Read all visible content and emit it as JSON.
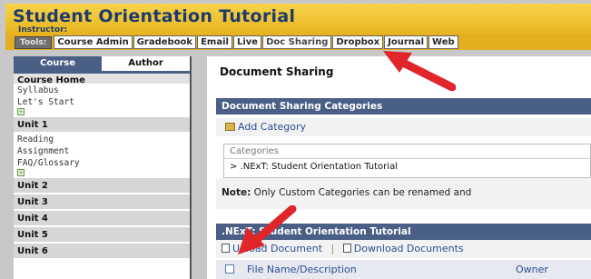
{
  "header": {
    "title": "Student Orientation Tutorial",
    "instructor_label": "Instructor:"
  },
  "toolbar": {
    "tools_label": "Tools:",
    "tabs": [
      "Course Admin",
      "Gradebook",
      "Email",
      "Live",
      "Doc Sharing",
      "Dropbox",
      "Journal",
      "Web"
    ]
  },
  "sidebar": {
    "tabs": [
      "Course",
      "Author"
    ],
    "course_home": "Course Home",
    "course_home_links": [
      "Syllabus",
      "Let's Start"
    ],
    "unit1": "Unit 1",
    "unit1_links": [
      "Reading",
      "Assignment",
      "FAQ/Glossary"
    ],
    "units": [
      "Unit 2",
      "Unit 3",
      "Unit 4",
      "Unit 5",
      "Unit 6"
    ]
  },
  "main": {
    "page_title": "Document Sharing",
    "categories_bar": "Document Sharing Categories",
    "add_category": "Add Category",
    "categories_header": "Categories",
    "category_row": ".NExT: Student Orientation Tutorial",
    "note_bold": "Note:",
    "note_text": " Only Custom Categories can be renamed and",
    "section_bar": ".NExT: Student Orientation Tutorial",
    "upload_document": "Upload Document",
    "download_documents": "Download Documents",
    "file_col": "File Name/Description",
    "owner_col": "Owner"
  },
  "colors": {
    "header_gold": "#f7d44a",
    "nav_blue": "#4a5f86",
    "link_blue": "#2a4f93",
    "arrow_red": "#e0262a"
  }
}
